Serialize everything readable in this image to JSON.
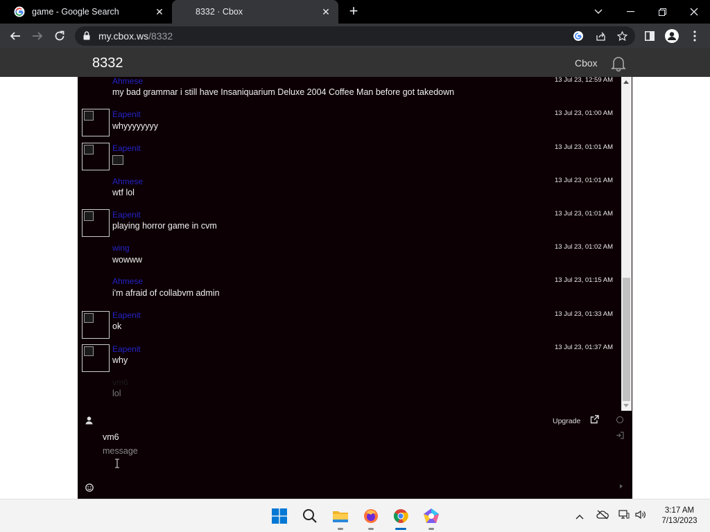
{
  "browser": {
    "tabs": [
      {
        "title": "game - Google Search",
        "icon": "google-icon",
        "active": false
      },
      {
        "title": "8332 · Cbox",
        "icon": "none",
        "active": true
      }
    ],
    "url_host": "my.cbox.ws",
    "url_path": "/8332"
  },
  "header": {
    "title": "8332",
    "cbox_label": "Cbox"
  },
  "messages": [
    {
      "user": "Ahmese",
      "text": "my bad grammar i still have Insaniquarium Deluxe 2004 Coffee Man before got takedown",
      "time": "13 Jul 23, 12:59 AM",
      "avatar": false
    },
    {
      "user": "Eapenit",
      "text": "whyyyyyyyy",
      "time": "13 Jul 23, 01:00 AM",
      "avatar": true
    },
    {
      "user": "Eapenit",
      "text": "",
      "image": true,
      "time": "13 Jul 23, 01:01 AM",
      "avatar": true
    },
    {
      "user": "Ahmese",
      "text": "wtf lol",
      "time": "13 Jul 23, 01:01 AM",
      "avatar": false
    },
    {
      "user": "Eapenit",
      "text": "playing horror game in cvm",
      "time": "13 Jul 23, 01:01 AM",
      "avatar": true
    },
    {
      "user": "wing",
      "text": "wowww",
      "time": "13 Jul 23, 01:02 AM",
      "avatar": false
    },
    {
      "user": "Ahmese",
      "text": "i'm afraid of collabvm admin",
      "time": "13 Jul 23, 01:15 AM",
      "avatar": false
    },
    {
      "user": "Eapenit",
      "text": "ok",
      "time": "13 Jul 23, 01:33 AM",
      "avatar": true
    },
    {
      "user": "Eapenit",
      "text": "why",
      "time": "13 Jul 23, 01:37 AM",
      "avatar": true
    },
    {
      "user": "vm6",
      "text": "lol",
      "time": "",
      "avatar": false,
      "pending": true
    }
  ],
  "form": {
    "upgrade_label": "Upgrade",
    "name_value": "vm6",
    "message_placeholder": "message"
  },
  "taskbar": {
    "time": "3:17 AM",
    "date": "7/13/2023"
  }
}
